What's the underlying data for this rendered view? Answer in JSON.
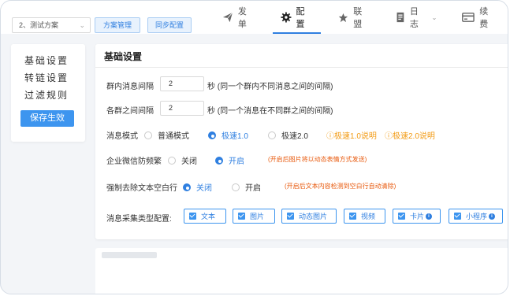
{
  "topbar": {
    "plan_select": "2、测试方案",
    "plan_manage_btn": "方案管理",
    "sync_config_btn": "同步配置",
    "nav": [
      {
        "label": "发单",
        "icon": "send-icon"
      },
      {
        "label": "配置",
        "icon": "gear-icon",
        "active": true
      },
      {
        "label": "联盟",
        "icon": "star-icon"
      },
      {
        "label": "日志",
        "icon": "document-icon",
        "has_dropdown": true
      },
      {
        "label": "续费",
        "icon": "card-icon"
      }
    ]
  },
  "sidebar": {
    "items": [
      "基础设置",
      "转链设置",
      "过滤规则"
    ],
    "save_button": "保存生效"
  },
  "main": {
    "title": "基础设置",
    "group_interval": {
      "label": "群内消息间隔",
      "value": "2",
      "hint": "秒 (同一个群内不同消息之间的间隔)"
    },
    "between_groups": {
      "label": "各群之间间隔",
      "value": "2",
      "hint": "秒 (同一个消息在不同群之间的间隔)"
    },
    "message_mode": {
      "label": "消息模式",
      "options": [
        "普通模式",
        "极速1.0",
        "极速2.0"
      ],
      "selected": "极速1.0",
      "links": [
        "ⓘ极速1.0说明",
        "ⓘ极速2.0说明"
      ]
    },
    "anti_frequent": {
      "label": "企业微信防频繁",
      "options": [
        "关闭",
        "开启"
      ],
      "selected": "开启",
      "note": "(开启后图片将以动态表情方式发送)"
    },
    "remove_blank": {
      "label": "强制去除文本空白行",
      "options": [
        "关闭",
        "开启"
      ],
      "selected": "关闭",
      "note": "(开启后文本内容检测到空白行自动清除)"
    },
    "collect_types": {
      "label": "消息采集类型配置:",
      "items": [
        "文本",
        "图片",
        "动态图片",
        "视频",
        "卡片",
        "小程序"
      ]
    }
  },
  "colors": {
    "accent": "#2f7fe0",
    "orange": "#f29a12",
    "note": "#e8590c"
  }
}
